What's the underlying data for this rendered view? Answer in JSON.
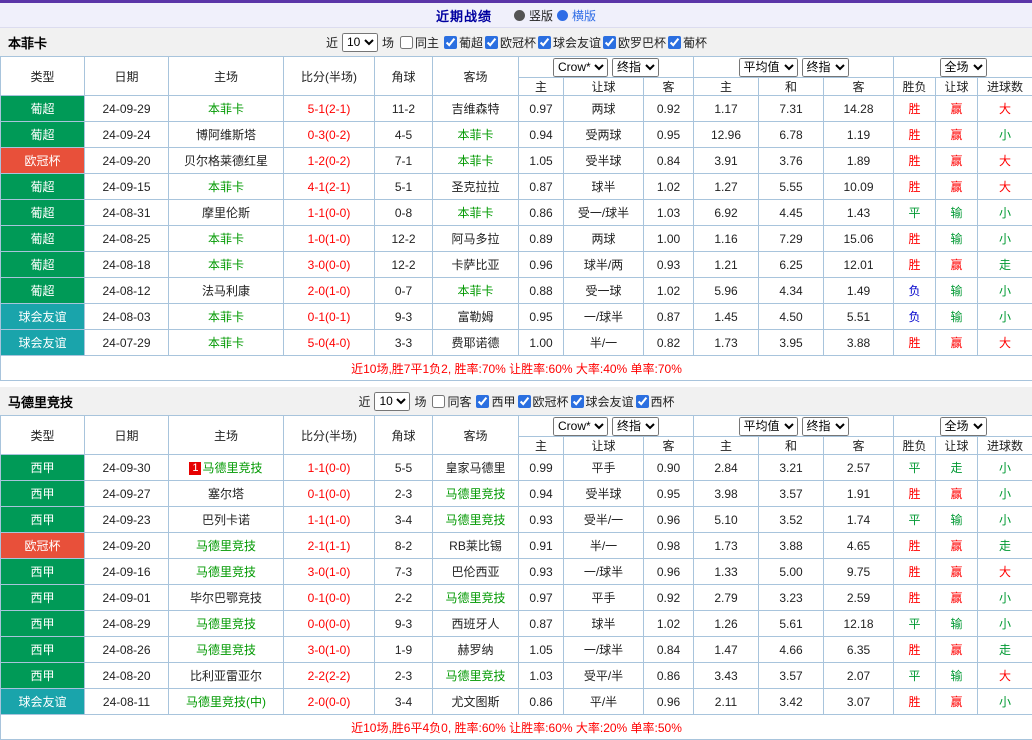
{
  "header": {
    "title": "近期战绩",
    "layout_options": [
      "竖版",
      "横版"
    ],
    "selected_layout": "横版"
  },
  "table_head": {
    "cols": [
      "类型",
      "日期",
      "主场",
      "比分(半场)",
      "角球",
      "客场"
    ],
    "sub": [
      "主",
      "让球",
      "客",
      "主",
      "和",
      "客",
      "胜负",
      "让球",
      "进球数"
    ],
    "selects": {
      "odds_provider": "Crow*",
      "odds_time": "终指",
      "average": "平均值",
      "average_time": "终指",
      "scope": "全场"
    }
  },
  "league_colors": {
    "葡超": "#009a57",
    "西甲": "#009a57",
    "欧冠杯": "#e8503a",
    "球会友谊": "#1aa4ab"
  },
  "result_colors": {
    "胜": "#ff0000",
    "赢": "#ff0000",
    "大": "#ff0000",
    "平": "#009933",
    "走": "#009933",
    "输": "#009933",
    "小": "#009933",
    "负": "#0000cc"
  },
  "focus_team_color": "#009900",
  "score_color": "#ff0000",
  "summary_color": "#ff0000",
  "tables": [
    {
      "team": "本菲卡",
      "filter": {
        "near_label": "近",
        "count": "10",
        "games_label": "场",
        "same_venue_label": "同主",
        "same_venue_checked": false,
        "leagues": [
          "葡超",
          "欧冠杯",
          "球会友谊",
          "欧罗巴杯",
          "葡杯"
        ]
      },
      "rows": [
        {
          "league": "葡超",
          "date": "24-09-29",
          "home": "本菲卡",
          "home_focus": true,
          "score": "5-1(2-1)",
          "corners": "11-2",
          "away": "吉维森特",
          "away_focus": false,
          "odds": [
            "0.97",
            "两球",
            "0.92"
          ],
          "avg": [
            "1.17",
            "7.31",
            "14.28"
          ],
          "results": [
            "胜",
            "赢",
            "大"
          ]
        },
        {
          "league": "葡超",
          "date": "24-09-24",
          "home": "博阿维斯塔",
          "home_focus": false,
          "score": "0-3(0-2)",
          "corners": "4-5",
          "away": "本菲卡",
          "away_focus": true,
          "odds": [
            "0.94",
            "受两球",
            "0.95"
          ],
          "avg": [
            "12.96",
            "6.78",
            "1.19"
          ],
          "results": [
            "胜",
            "赢",
            "小"
          ]
        },
        {
          "league": "欧冠杯",
          "date": "24-09-20",
          "home": "贝尔格莱德红星",
          "home_focus": false,
          "score": "1-2(0-2)",
          "corners": "7-1",
          "away": "本菲卡",
          "away_focus": true,
          "odds": [
            "1.05",
            "受半球",
            "0.84"
          ],
          "avg": [
            "3.91",
            "3.76",
            "1.89"
          ],
          "results": [
            "胜",
            "赢",
            "大"
          ]
        },
        {
          "league": "葡超",
          "date": "24-09-15",
          "home": "本菲卡",
          "home_focus": true,
          "score": "4-1(2-1)",
          "corners": "5-1",
          "away": "圣克拉拉",
          "away_focus": false,
          "odds": [
            "0.87",
            "球半",
            "1.02"
          ],
          "avg": [
            "1.27",
            "5.55",
            "10.09"
          ],
          "results": [
            "胜",
            "赢",
            "大"
          ]
        },
        {
          "league": "葡超",
          "date": "24-08-31",
          "home": "摩里伦斯",
          "home_focus": false,
          "score": "1-1(0-0)",
          "corners": "0-8",
          "away": "本菲卡",
          "away_focus": true,
          "odds": [
            "0.86",
            "受一/球半",
            "1.03"
          ],
          "avg": [
            "6.92",
            "4.45",
            "1.43"
          ],
          "results": [
            "平",
            "输",
            "小"
          ]
        },
        {
          "league": "葡超",
          "date": "24-08-25",
          "home": "本菲卡",
          "home_focus": true,
          "score": "1-0(1-0)",
          "corners": "12-2",
          "away": "阿马多拉",
          "away_focus": false,
          "odds": [
            "0.89",
            "两球",
            "1.00"
          ],
          "avg": [
            "1.16",
            "7.29",
            "15.06"
          ],
          "results": [
            "胜",
            "输",
            "小"
          ]
        },
        {
          "league": "葡超",
          "date": "24-08-18",
          "home": "本菲卡",
          "home_focus": true,
          "score": "3-0(0-0)",
          "corners": "12-2",
          "away": "卡萨比亚",
          "away_focus": false,
          "odds": [
            "0.96",
            "球半/两",
            "0.93"
          ],
          "avg": [
            "1.21",
            "6.25",
            "12.01"
          ],
          "results": [
            "胜",
            "赢",
            "走"
          ]
        },
        {
          "league": "葡超",
          "date": "24-08-12",
          "home": "法马利康",
          "home_focus": false,
          "score": "2-0(1-0)",
          "corners": "0-7",
          "away": "本菲卡",
          "away_focus": true,
          "odds": [
            "0.88",
            "受一球",
            "1.02"
          ],
          "avg": [
            "5.96",
            "4.34",
            "1.49"
          ],
          "results": [
            "负",
            "输",
            "小"
          ]
        },
        {
          "league": "球会友谊",
          "date": "24-08-03",
          "home": "本菲卡",
          "home_focus": true,
          "score": "0-1(0-1)",
          "corners": "9-3",
          "away": "富勒姆",
          "away_focus": false,
          "odds": [
            "0.95",
            "一/球半",
            "0.87"
          ],
          "avg": [
            "1.45",
            "4.50",
            "5.51"
          ],
          "results": [
            "负",
            "输",
            "小"
          ]
        },
        {
          "league": "球会友谊",
          "date": "24-07-29",
          "home": "本菲卡",
          "home_focus": true,
          "score": "5-0(4-0)",
          "corners": "3-3",
          "away": "费耶诺德",
          "away_focus": false,
          "odds": [
            "1.00",
            "半/一",
            "0.82"
          ],
          "avg": [
            "1.73",
            "3.95",
            "3.88"
          ],
          "results": [
            "胜",
            "赢",
            "大"
          ]
        }
      ],
      "summary": "近10场,胜7平1负2, 胜率:70% 让胜率:60% 大率:40% 单率:70%"
    },
    {
      "team": "马德里竞技",
      "filter": {
        "near_label": "近",
        "count": "10",
        "games_label": "场",
        "same_venue_label": "同客",
        "same_venue_checked": false,
        "leagues": [
          "西甲",
          "欧冠杯",
          "球会友谊",
          "西杯"
        ]
      },
      "rows": [
        {
          "league": "西甲",
          "date": "24-09-30",
          "home": "马德里竞技",
          "home_focus": true,
          "badge": "1",
          "score": "1-1(0-0)",
          "corners": "5-5",
          "away": "皇家马德里",
          "away_focus": false,
          "odds": [
            "0.99",
            "平手",
            "0.90"
          ],
          "avg": [
            "2.84",
            "3.21",
            "2.57"
          ],
          "results": [
            "平",
            "走",
            "小"
          ]
        },
        {
          "league": "西甲",
          "date": "24-09-27",
          "home": "塞尔塔",
          "home_focus": false,
          "score": "0-1(0-0)",
          "corners": "2-3",
          "away": "马德里竞技",
          "away_focus": true,
          "odds": [
            "0.94",
            "受半球",
            "0.95"
          ],
          "avg": [
            "3.98",
            "3.57",
            "1.91"
          ],
          "results": [
            "胜",
            "赢",
            "小"
          ]
        },
        {
          "league": "西甲",
          "date": "24-09-23",
          "home": "巴列卡诺",
          "home_focus": false,
          "score": "1-1(1-0)",
          "corners": "3-4",
          "away": "马德里竞技",
          "away_focus": true,
          "odds": [
            "0.93",
            "受半/一",
            "0.96"
          ],
          "avg": [
            "5.10",
            "3.52",
            "1.74"
          ],
          "results": [
            "平",
            "输",
            "小"
          ]
        },
        {
          "league": "欧冠杯",
          "date": "24-09-20",
          "home": "马德里竞技",
          "home_focus": true,
          "score": "2-1(1-1)",
          "corners": "8-2",
          "away": "RB莱比锡",
          "away_focus": false,
          "odds": [
            "0.91",
            "半/一",
            "0.98"
          ],
          "avg": [
            "1.73",
            "3.88",
            "4.65"
          ],
          "results": [
            "胜",
            "赢",
            "走"
          ]
        },
        {
          "league": "西甲",
          "date": "24-09-16",
          "home": "马德里竞技",
          "home_focus": true,
          "score": "3-0(1-0)",
          "corners": "7-3",
          "away": "巴伦西亚",
          "away_focus": false,
          "odds": [
            "0.93",
            "一/球半",
            "0.96"
          ],
          "avg": [
            "1.33",
            "5.00",
            "9.75"
          ],
          "results": [
            "胜",
            "赢",
            "大"
          ]
        },
        {
          "league": "西甲",
          "date": "24-09-01",
          "home": "毕尔巴鄂竞技",
          "home_focus": false,
          "score": "0-1(0-0)",
          "corners": "2-2",
          "away": "马德里竞技",
          "away_focus": true,
          "odds": [
            "0.97",
            "平手",
            "0.92"
          ],
          "avg": [
            "2.79",
            "3.23",
            "2.59"
          ],
          "results": [
            "胜",
            "赢",
            "小"
          ]
        },
        {
          "league": "西甲",
          "date": "24-08-29",
          "home": "马德里竞技",
          "home_focus": true,
          "score": "0-0(0-0)",
          "corners": "9-3",
          "away": "西班牙人",
          "away_focus": false,
          "odds": [
            "0.87",
            "球半",
            "1.02"
          ],
          "avg": [
            "1.26",
            "5.61",
            "12.18"
          ],
          "results": [
            "平",
            "输",
            "小"
          ]
        },
        {
          "league": "西甲",
          "date": "24-08-26",
          "home": "马德里竞技",
          "home_focus": true,
          "score": "3-0(1-0)",
          "corners": "1-9",
          "away": "赫罗纳",
          "away_focus": false,
          "odds": [
            "1.05",
            "一/球半",
            "0.84"
          ],
          "avg": [
            "1.47",
            "4.66",
            "6.35"
          ],
          "results": [
            "胜",
            "赢",
            "走"
          ]
        },
        {
          "league": "西甲",
          "date": "24-08-20",
          "home": "比利亚雷亚尔",
          "home_focus": false,
          "score": "2-2(2-2)",
          "corners": "2-3",
          "away": "马德里竞技",
          "away_focus": true,
          "odds": [
            "1.03",
            "受平/半",
            "0.86"
          ],
          "avg": [
            "3.43",
            "3.57",
            "2.07"
          ],
          "results": [
            "平",
            "输",
            "大"
          ]
        },
        {
          "league": "球会友谊",
          "date": "24-08-11",
          "home": "马德里竞技(中)",
          "home_focus": true,
          "score": "2-0(0-0)",
          "corners": "3-4",
          "away": "尤文图斯",
          "away_focus": false,
          "odds": [
            "0.86",
            "平/半",
            "0.96"
          ],
          "avg": [
            "2.11",
            "3.42",
            "3.07"
          ],
          "results": [
            "胜",
            "赢",
            "小"
          ]
        }
      ],
      "summary": "近10场,胜6平4负0, 胜率:60% 让胜率:60% 大率:20% 单率:50%"
    }
  ]
}
